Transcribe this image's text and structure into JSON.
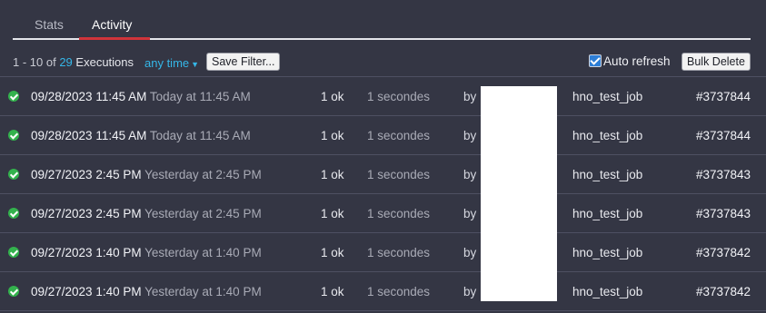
{
  "tabs": [
    {
      "label": "Stats",
      "active": false
    },
    {
      "label": "Activity",
      "active": true
    }
  ],
  "toolbar": {
    "range": "1 - 10 of",
    "count": "29",
    "executions_label": "Executions",
    "time_filter": "any time",
    "save_filter": "Save Filter...",
    "auto_refresh": "Auto refresh",
    "auto_refresh_checked": true,
    "bulk_delete": "Bulk Delete"
  },
  "executions": [
    {
      "date": "09/28/2023 11:45 AM",
      "relative": "Today at 11:45 AM",
      "ok": "1 ok",
      "duration": "1 secondes",
      "by": "by",
      "job": "hno_test_job",
      "id": "#3737844",
      "status": "success"
    },
    {
      "date": "09/28/2023 11:45 AM",
      "relative": "Today at 11:45 AM",
      "ok": "1 ok",
      "duration": "1 secondes",
      "by": "by",
      "job": "hno_test_job",
      "id": "#3737844",
      "status": "success"
    },
    {
      "date": "09/27/2023 2:45 PM",
      "relative": "Yesterday at 2:45 PM",
      "ok": "1 ok",
      "duration": "1 secondes",
      "by": "by",
      "job": "hno_test_job",
      "id": "#3737843",
      "status": "success"
    },
    {
      "date": "09/27/2023 2:45 PM",
      "relative": "Yesterday at 2:45 PM",
      "ok": "1 ok",
      "duration": "1 secondes",
      "by": "by",
      "job": "hno_test_job",
      "id": "#3737843",
      "status": "success"
    },
    {
      "date": "09/27/2023 1:40 PM",
      "relative": "Yesterday at 1:40 PM",
      "ok": "1 ok",
      "duration": "1 secondes",
      "by": "by",
      "job": "hno_test_job",
      "id": "#3737842",
      "status": "success"
    },
    {
      "date": "09/27/2023 1:40 PM",
      "relative": "Yesterday at 1:40 PM",
      "ok": "1 ok",
      "duration": "1 secondes",
      "by": "by",
      "job": "hno_test_job",
      "id": "#3737842",
      "status": "success"
    }
  ]
}
